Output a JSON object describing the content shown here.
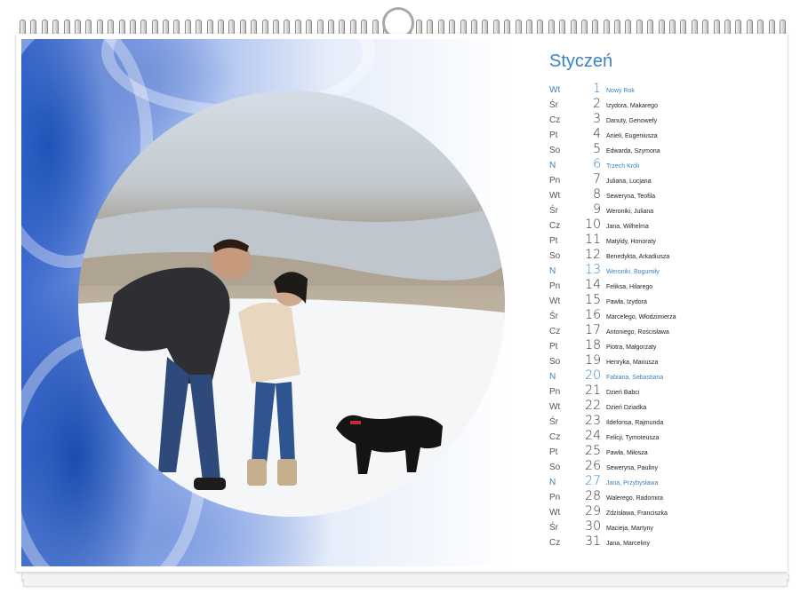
{
  "calendar": {
    "month": "Styczeń",
    "days": [
      {
        "weekday": "Wt",
        "day": "1",
        "names": "Nowy Rok",
        "holiday": true
      },
      {
        "weekday": "Śr",
        "day": "2",
        "names": "Izydora, Makarego",
        "holiday": false
      },
      {
        "weekday": "Cz",
        "day": "3",
        "names": "Danuty, Genowefy",
        "holiday": false
      },
      {
        "weekday": "Pt",
        "day": "4",
        "names": "Anieli, Eugeniusza",
        "holiday": false
      },
      {
        "weekday": "So",
        "day": "5",
        "names": "Edwarda, Szymona",
        "holiday": false
      },
      {
        "weekday": "N",
        "day": "6",
        "names": "Trzech Króli",
        "holiday": true
      },
      {
        "weekday": "Pn",
        "day": "7",
        "names": "Juliana, Lucjana",
        "holiday": false
      },
      {
        "weekday": "Wt",
        "day": "8",
        "names": "Seweryna, Teofila",
        "holiday": false
      },
      {
        "weekday": "Śr",
        "day": "9",
        "names": "Weroniki, Juliana",
        "holiday": false
      },
      {
        "weekday": "Cz",
        "day": "10",
        "names": "Jana, Wilhelma",
        "holiday": false
      },
      {
        "weekday": "Pt",
        "day": "11",
        "names": "Matyldy, Honoraty",
        "holiday": false
      },
      {
        "weekday": "So",
        "day": "12",
        "names": "Benedykta, Arkadiusza",
        "holiday": false
      },
      {
        "weekday": "N",
        "day": "13",
        "names": "Weroniki, Bogumiły",
        "holiday": true
      },
      {
        "weekday": "Pn",
        "day": "14",
        "names": "Feliksa, Hilarego",
        "holiday": false
      },
      {
        "weekday": "Wt",
        "day": "15",
        "names": "Pawła, Izydora",
        "holiday": false
      },
      {
        "weekday": "Śr",
        "day": "16",
        "names": "Marcelego, Włodzimierza",
        "holiday": false
      },
      {
        "weekday": "Cz",
        "day": "17",
        "names": "Antoniego, Rościsława",
        "holiday": false
      },
      {
        "weekday": "Pt",
        "day": "18",
        "names": "Piotra, Małgorzaty",
        "holiday": false
      },
      {
        "weekday": "So",
        "day": "19",
        "names": "Henryka, Mariusza",
        "holiday": false
      },
      {
        "weekday": "N",
        "day": "20",
        "names": "Fabiana, Sebastiana",
        "holiday": true
      },
      {
        "weekday": "Pn",
        "day": "21",
        "names": "Dzień Babci",
        "holiday": false
      },
      {
        "weekday": "Wt",
        "day": "22",
        "names": "Dzień Dziadka",
        "holiday": false
      },
      {
        "weekday": "Śr",
        "day": "23",
        "names": "Ildefonsa, Rajmunda",
        "holiday": false
      },
      {
        "weekday": "Cz",
        "day": "24",
        "names": "Felicji, Tymoteusza",
        "holiday": false
      },
      {
        "weekday": "Pt",
        "day": "25",
        "names": "Pawła, Miłosza",
        "holiday": false
      },
      {
        "weekday": "So",
        "day": "26",
        "names": "Seweryna, Pauliny",
        "holiday": false
      },
      {
        "weekday": "N",
        "day": "27",
        "names": "Jana, Przybysława",
        "holiday": true
      },
      {
        "weekday": "Pn",
        "day": "28",
        "names": "Walerego, Radomira",
        "holiday": false
      },
      {
        "weekday": "Wt",
        "day": "29",
        "names": "Zdzisława, Franciszka",
        "holiday": false
      },
      {
        "weekday": "Śr",
        "day": "30",
        "names": "Macieja, Martyny",
        "holiday": false
      },
      {
        "weekday": "Cz",
        "day": "31",
        "names": "Jana, Marceliny",
        "holiday": false
      }
    ]
  },
  "colors": {
    "accent": "#3b82c4",
    "marble_blue": "#1e54b8"
  }
}
